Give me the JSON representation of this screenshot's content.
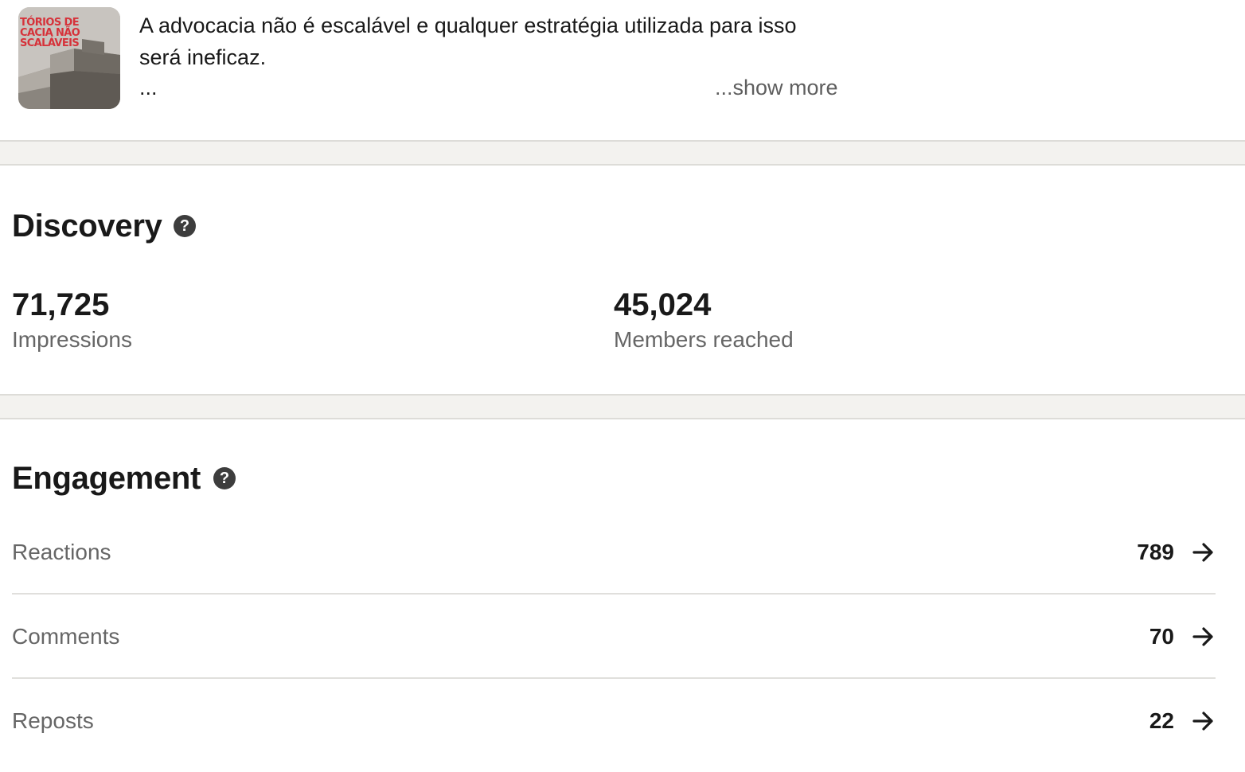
{
  "post": {
    "thumbnail_text": "TÓRIOS DE\nCACIA NÃO\nSCALÁVEIS",
    "text_line1": "A advocacia não é escalável e qualquer estratégia utilizada para isso",
    "text_line2": "será ineficaz.",
    "ellipsis": "...",
    "show_more": "...show more"
  },
  "discovery": {
    "title": "Discovery",
    "help_icon": "?",
    "metrics": [
      {
        "value": "71,725",
        "label": "Impressions"
      },
      {
        "value": "45,024",
        "label": "Members reached"
      }
    ]
  },
  "engagement": {
    "title": "Engagement",
    "help_icon": "?",
    "rows": [
      {
        "label": "Reactions",
        "count": "789",
        "icon": "arrow-right-icon"
      },
      {
        "label": "Comments",
        "count": "70",
        "icon": "arrow-right-icon"
      },
      {
        "label": "Reposts",
        "count": "22",
        "icon": "arrow-right-icon"
      }
    ]
  },
  "colors": {
    "text_primary": "#191919",
    "text_secondary": "#666666",
    "separator_bg": "#f3f2ef",
    "thumbnail_title": "#d6323a"
  }
}
